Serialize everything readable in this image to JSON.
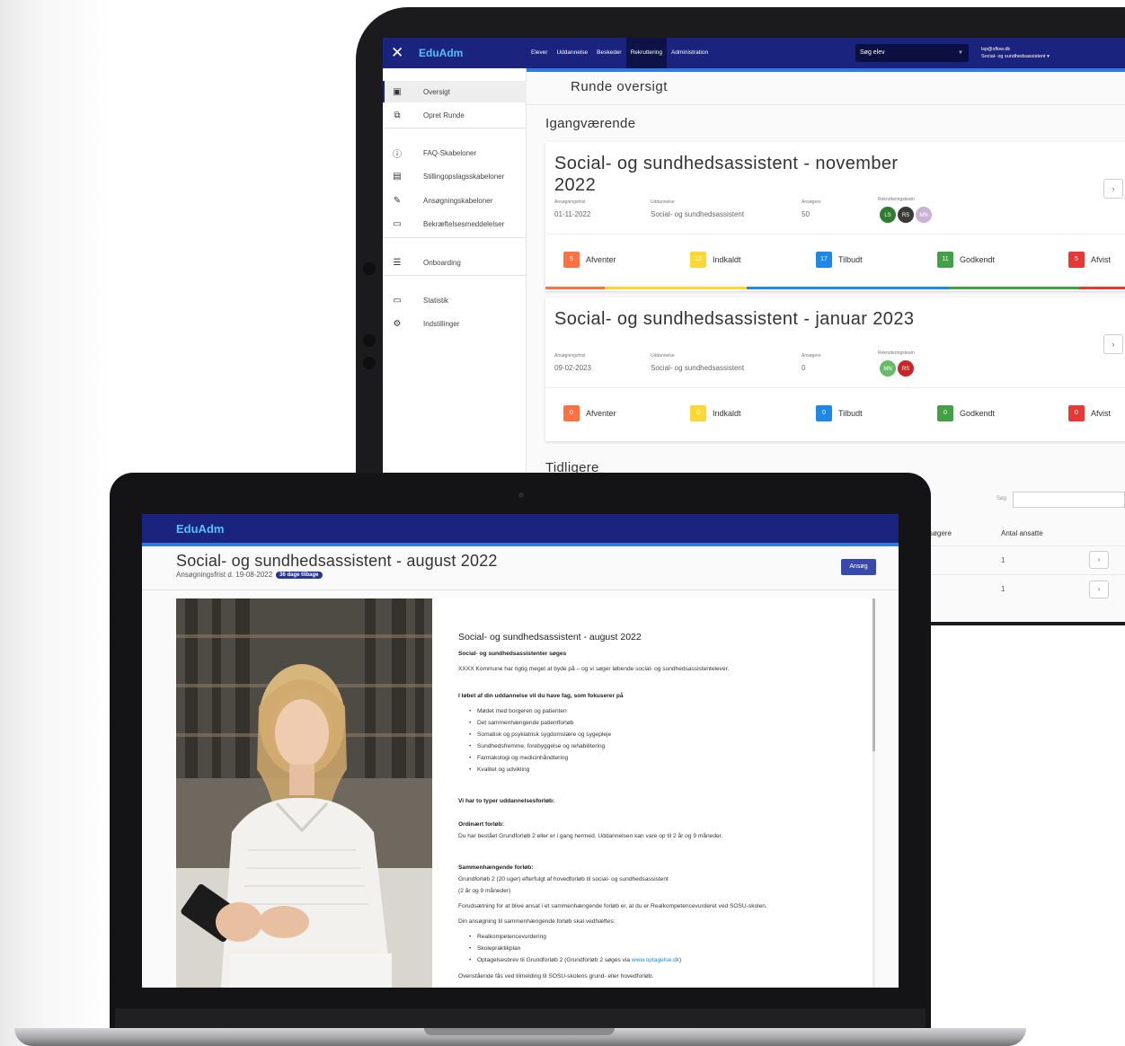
{
  "monitor": {
    "brand": "EduAdm",
    "nav": [
      "Elever",
      "Uddannelse",
      "Beskeder",
      "Rekruttering",
      "Administration"
    ],
    "nav_active": "Rekruttering",
    "search_label": "Søg elev",
    "user_email": "lsp@xflow.dk",
    "user_role": "Social- og sundhedsassistent",
    "sidebar": [
      {
        "label": "Oversigt",
        "icon": "dashboard-icon"
      },
      {
        "label": "Opret Runde",
        "icon": "copy-icon"
      },
      {
        "label": "FAQ-Skabeloner",
        "icon": "info-icon"
      },
      {
        "label": "Stillingopslagsskabeloner",
        "icon": "document-icon"
      },
      {
        "label": "Ansøgningskabeloner",
        "icon": "pencil-icon"
      },
      {
        "label": "Bekræftelsesmeddelelser",
        "icon": "message-icon"
      },
      {
        "label": "Onboarding",
        "icon": "checklist-icon"
      },
      {
        "label": "Statistik",
        "icon": "chart-icon"
      },
      {
        "label": "Indstillinger",
        "icon": "settings-icon"
      }
    ],
    "page_title": "Runde oversigt",
    "section_active": "Igangværende",
    "section_previous": "Tidligere",
    "rounds": [
      {
        "title_line1": "Social- og sundhedsassistent - november",
        "title_line2": "2022",
        "deadline_label": "Ansøgningsfrist",
        "deadline": "01-11-2022",
        "education_label": "Uddannelse",
        "education": "Social- og sundhedsassistent",
        "applicants_label": "Ansøgere",
        "applicants": "50",
        "team_label": "Rekrutteringsteam",
        "team": [
          {
            "initials": "LS",
            "color": "#2e7d32"
          },
          {
            "initials": "RS",
            "color": "#3a3a3a"
          },
          {
            "initials": "MN",
            "color": "#c9b2d4"
          }
        ],
        "stats": [
          {
            "label": "Afventer",
            "count": "5",
            "color": "#ff7043"
          },
          {
            "label": "Indkaldt",
            "count": "12",
            "color": "#fdd835"
          },
          {
            "label": "Tilbudt",
            "count": "17",
            "color": "#1e88e5"
          },
          {
            "label": "Godkendt",
            "count": "11",
            "color": "#43a047"
          },
          {
            "label": "Afvist",
            "count": "5",
            "color": "#e53935"
          }
        ]
      },
      {
        "title_line1": "Social- og sundhedsassistent - januar 2023",
        "title_line2": "",
        "deadline_label": "Ansøgningsfrist",
        "deadline": "09-02-2023",
        "education_label": "Uddannelse",
        "education": "Social- og sundhedsassistent",
        "applicants_label": "Ansøgere",
        "applicants": "0",
        "team_label": "Rekrutteringsteam",
        "team": [
          {
            "initials": "MN",
            "color": "#66bb6a"
          },
          {
            "initials": "RS",
            "color": "#c62828"
          }
        ],
        "stats": [
          {
            "label": "Afventer",
            "count": "0",
            "color": "#ff7043"
          },
          {
            "label": "Indkaldt",
            "count": "0",
            "color": "#fdd835"
          },
          {
            "label": "Tilbudt",
            "count": "0",
            "color": "#1e88e5"
          },
          {
            "label": "Godkendt",
            "count": "0",
            "color": "#43a047"
          },
          {
            "label": "Afvist",
            "count": "0",
            "color": "#e53935"
          }
        ]
      }
    ],
    "table": {
      "search_label": "Søg",
      "headers": [
        "søgere",
        "Antal ansatte"
      ],
      "rows": [
        {
          "ansatte": "1"
        },
        {
          "ansatte": "1"
        }
      ]
    }
  },
  "laptop": {
    "brand": "EduAdm",
    "title": "Social- og sundhedsassistent - august 2022",
    "deadline_text": "Ansøgningsfrist d. 19-08-2022",
    "deadline_pill": "36 dage tilbage",
    "apply_label": "Ansøg",
    "content": {
      "heading": "Social- og sundhedsassistent - august 2022",
      "sub1": "Social- og sundhedsassistenter søges",
      "p1": "XXXX Kommune har rigtig meget at byde på – og vi søger løbende social- og sundhedsassistentelever.",
      "sub2": "I løbet af din uddannelse vil du have fag, som fokuserer på",
      "list1": [
        "Mødet med borgeren og patienten",
        "Det sammenhængende patientforløb",
        "Somatisk og psykiatrisk sygdomslære og sygepleje",
        "Sundhedsfremme, forebyggelse og rehabilitering",
        "Farmakologi og medicinhåndtering",
        "Kvalitet og udvikling"
      ],
      "sub3": "Vi har to typer uddannelsesforløb:",
      "sub4": "Ordinært forløb:",
      "p2": "Du har bestået Grundforløb 2 eller er i gang hermed. Uddannelsen kan vare op til 2 år og 9 måneder.",
      "sub5": "Sammenhængende forløb:",
      "p3": "Grundforløb 2 (20 uger) efterfulgt af hovedforløb til social- og sundhedsassistent",
      "p4": "(2 år og 9 måneder)",
      "p5": "Forudsætning for at blive ansat i et sammenhængende forløb er, at du er Realkompetencevurderet ved SOSU-skolen.",
      "p6": "Din ansøgning til sammenhængende forløb skal vedhæftes:",
      "list2": [
        "Realkompetencevurdering",
        "Skolepraktikplan"
      ],
      "list2_last_prefix": "Optagelsesbrev til Grundforløb 2 (Grundforløb 2 søges via ",
      "list2_last_link": "www.optagelse.dk",
      "list2_last_suffix": ")",
      "p7": "Ovenstående fås ved tilmelding til SOSU-skolens grund- eller hovedforløb."
    }
  }
}
